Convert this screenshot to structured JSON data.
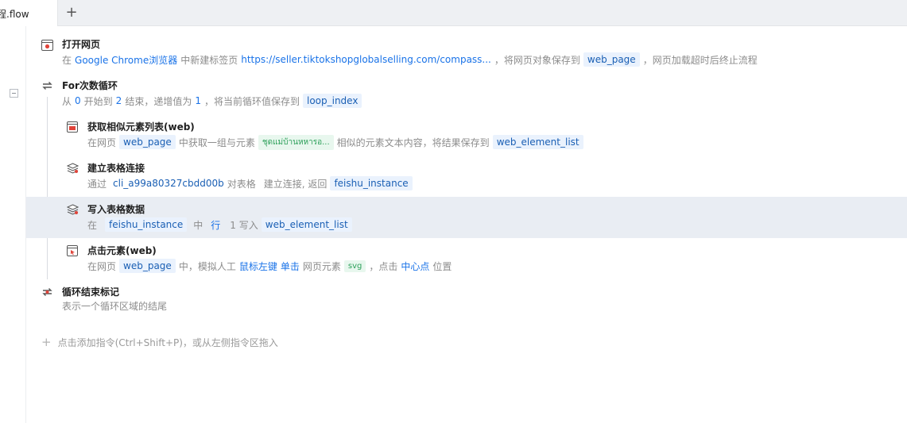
{
  "tab": {
    "title": "程.flow",
    "add_icon": "+"
  },
  "steps": [
    {
      "title": "打开网页",
      "icon": "browser-open-icon",
      "desc": [
        "在",
        "Google Chrome浏览器",
        "中新建标签页",
        "https://seller.tiktokshopglobalselling.com/compass...",
        "，将网页对象保存到",
        "web_page",
        "，网页加载超时后终止流程"
      ]
    },
    {
      "title": "For次数循环",
      "icon": "loop-icon",
      "desc": [
        "从",
        "0",
        "开始到",
        "2",
        "结束，递增值为",
        "1",
        "，将当前循环值保存到",
        "loop_index"
      ]
    },
    {
      "title": "获取相似元素列表(web)",
      "icon": "element-list-icon",
      "desc": [
        "在网页",
        "web_page",
        "中获取一组与元素",
        "ชุดแม่บ้านหหารอ...",
        "相似的元素文本内容，将结果保存到",
        "web_element_list"
      ]
    },
    {
      "title": "建立表格连接",
      "icon": "table-connect-icon",
      "desc": [
        "通过",
        "cli_a99a80327cbdd00b",
        "对表格",
        "建立连接, 返回",
        "feishu_instance"
      ]
    },
    {
      "title": "写入表格数据",
      "icon": "table-write-icon",
      "desc": [
        "在",
        "feishu_instance",
        "中",
        "行",
        "1 写入",
        "web_element_list"
      ]
    },
    {
      "title": "点击元素(web)",
      "icon": "click-element-icon",
      "desc": [
        "在网页",
        "web_page",
        "中，模拟人工",
        "鼠标左键",
        "单击",
        "网页元素",
        "svg",
        "，点击",
        "中心点",
        "位置"
      ]
    },
    {
      "title": "循环结束标记",
      "icon": "loop-end-icon",
      "desc": [
        "表示一个循环区域的结尾"
      ]
    }
  ],
  "add_command": "点击添加指令(Ctrl+Shift+P)，或从左侧指令区拖入",
  "colors": {
    "accent": "#1a73e8",
    "tag_bg": "#eaf2fd",
    "selected_row": "#e9edf3",
    "icon_red": "#e0443a"
  }
}
